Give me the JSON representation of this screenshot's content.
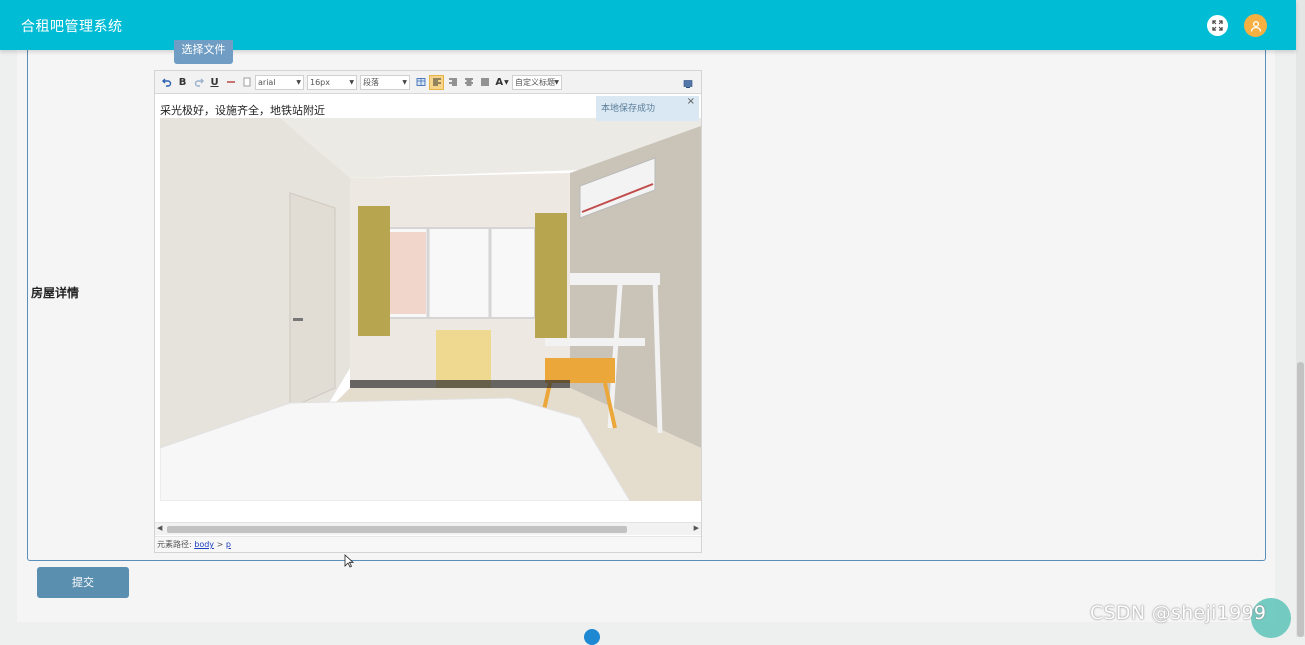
{
  "header": {
    "app_title": "合租吧管理系统",
    "colors": {
      "bar": "#00bcd4",
      "avatar": "#f5b041"
    }
  },
  "form": {
    "file_button_label": "选择文件",
    "field_label": "房屋详情",
    "submit_label": "提交"
  },
  "editor": {
    "toolbar": {
      "bold": "B",
      "underline": "U",
      "font_family": "arial",
      "font_size": "16px",
      "paragraph": "段落",
      "font_color": "A",
      "custom_title": "自定义标题"
    },
    "content_text": "采光极好，设施齐全，地铁站附近",
    "toast_text": "本地保存成功",
    "toast_close": "×",
    "path_prefix": "元素路径:",
    "path_body": "body",
    "path_sep": ">",
    "path_p": "p"
  },
  "watermark": "CSDN @sheji1999"
}
